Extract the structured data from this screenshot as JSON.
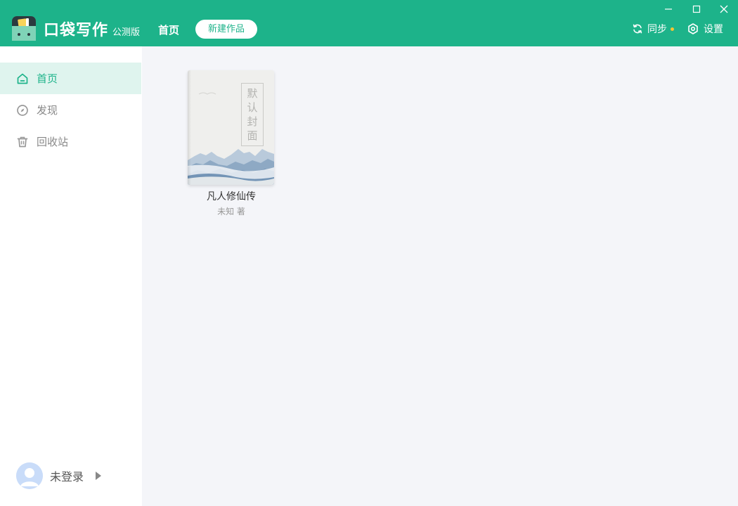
{
  "app": {
    "brand": "口袋写作",
    "edition": "公测版"
  },
  "header": {
    "nav_home": "首页",
    "new_work_button": "新建作品",
    "sync_label": "同步",
    "settings_label": "设置"
  },
  "window_controls": {
    "minimize_icon": "minimize-icon",
    "maximize_icon": "maximize-icon",
    "close_icon": "close-icon"
  },
  "sidebar": {
    "items": [
      {
        "label": "首页",
        "icon": "home-icon",
        "active": true
      },
      {
        "label": "发现",
        "icon": "compass-icon",
        "active": false
      },
      {
        "label": "回收站",
        "icon": "trash-icon",
        "active": false
      }
    ],
    "user": {
      "name": "未登录",
      "icon": "avatar-icon"
    }
  },
  "books": [
    {
      "title": "凡人修仙传",
      "author": "未知 著",
      "cover_label": [
        "默",
        "认",
        "封",
        "面"
      ]
    }
  ],
  "colors": {
    "accent": "#1db38a",
    "sidebar_active_bg": "#dff4ee",
    "content_bg": "#f4f5f9",
    "sync_indicator": "#f7c531"
  }
}
